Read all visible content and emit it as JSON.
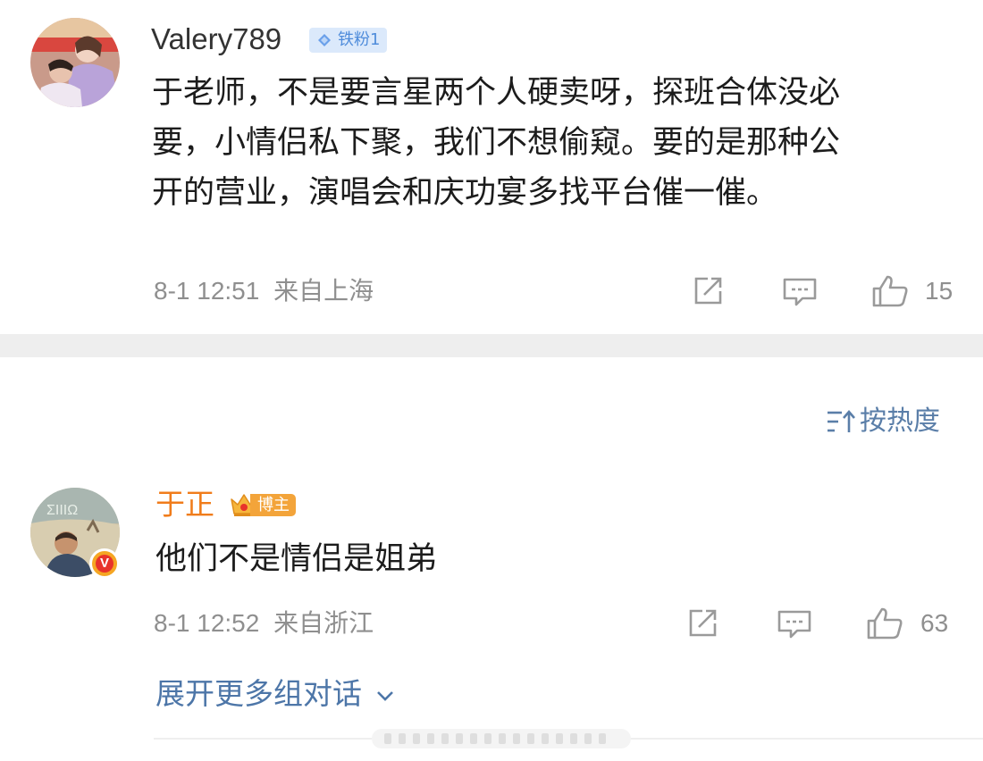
{
  "comments": [
    {
      "username": "Valery789",
      "badge": {
        "icon": "diamond-icon",
        "label": "铁粉1"
      },
      "text": "于老师，不是要言星两个人硬卖呀，探班合体没必要，小情侣私下聚，我们不想偷窥。要的是那种公开的营业，演唱会和庆功宴多找平台催一催。",
      "lines": [
        "于老师，不是要言星两个人硬卖呀，探班合体没必",
        "要，小情侣私下聚，我们不想偷窥。要的是那种公",
        "开的营业，演唱会和庆功宴多找平台催一催。"
      ],
      "timestamp": "8-1 12:51",
      "location": "来自上海",
      "likes": "15"
    },
    {
      "username": "于正",
      "badge": {
        "icon": "crown-icon",
        "label": "博主"
      },
      "verified_badge": "V",
      "text": "他们不是情侣是姐弟",
      "timestamp": "8-1 12:52",
      "location": "来自浙江",
      "likes": "63"
    }
  ],
  "sort_toggle": {
    "icon": "sort-icon",
    "label": "按热度"
  },
  "expand_link": {
    "label": "展开更多组对话",
    "icon": "chevron-down-icon"
  },
  "icons": {
    "share": "share-icon",
    "comment": "comment-icon",
    "like": "thumbs-up-icon"
  },
  "colors": {
    "username_orange": "#f07c1b",
    "link_blue": "#4d76a8",
    "fan_badge_bg": "#dbe9fb",
    "fan_badge_text": "#4f8cdb",
    "blogger_badge": "#f3a43a",
    "meta_grey": "#8f8f8f"
  }
}
